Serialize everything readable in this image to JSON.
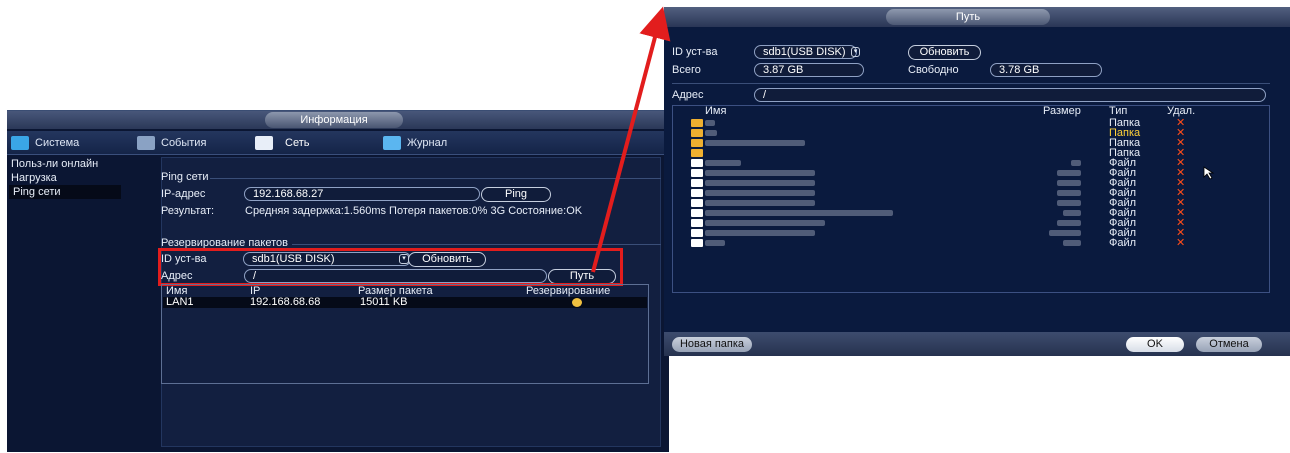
{
  "info_window": {
    "title": "Информация",
    "tabs": [
      {
        "label": "Система",
        "icon": "monitor-icon"
      },
      {
        "label": "События",
        "icon": "events-icon"
      },
      {
        "label": "Сеть",
        "icon": "network-icon"
      },
      {
        "label": "Журнал",
        "icon": "log-icon"
      }
    ],
    "sidebar": [
      "Польз-ли онлайн",
      "Нагрузка",
      "Ping сети"
    ],
    "ping": {
      "section": "Ping сети",
      "ip_label": "IP-адрес",
      "ip_value": "192.168.68.27",
      "ping_button": "Ping",
      "result_label": "Результат:",
      "result_value": "Средняя задержка:1.560ms Потеря пакетов:0% 3G Состояние:OK"
    },
    "backup": {
      "section": "Резервирование пакетов",
      "device_label": "ID уст-ва",
      "device_value": "sdb1(USB DISK)",
      "refresh_button": "Обновить",
      "path_label": "Адрес",
      "path_value": "/",
      "path_button": "Путь"
    },
    "table": {
      "headers": [
        "Имя",
        "IP",
        "Размер пакета",
        "Резервирование"
      ],
      "rows": [
        {
          "name": "LAN1",
          "ip": "192.168.68.68",
          "size": "15011 KB"
        }
      ]
    }
  },
  "path_window": {
    "title": "Путь",
    "device_label": "ID уст-ва",
    "device_value": "sdb1(USB DISK)",
    "refresh_button": "Обновить",
    "total_label": "Всего",
    "total_value": "3.87 GB",
    "free_label": "Свободно",
    "free_value": "3.78 GB",
    "address_label": "Адрес",
    "address_value": "/",
    "columns": [
      "Имя",
      "Размер",
      "Тип",
      "Удал."
    ],
    "files": [
      {
        "type": "Папка",
        "highlight": false,
        "icon": "folder-icon"
      },
      {
        "type": "Папка",
        "highlight": true,
        "icon": "folder-icon"
      },
      {
        "type": "Папка",
        "highlight": false,
        "icon": "folder-icon"
      },
      {
        "type": "Папка",
        "highlight": false,
        "icon": "folder-icon"
      },
      {
        "type": "Файл",
        "highlight": false,
        "icon": "file-icon"
      },
      {
        "type": "Файл",
        "highlight": false,
        "icon": "file-icon"
      },
      {
        "type": "Файл",
        "highlight": false,
        "icon": "file-icon"
      },
      {
        "type": "Файл",
        "highlight": false,
        "icon": "file-icon"
      },
      {
        "type": "Файл",
        "highlight": false,
        "icon": "file-icon"
      },
      {
        "type": "Файл",
        "highlight": false,
        "icon": "file-icon"
      },
      {
        "type": "Файл",
        "highlight": false,
        "icon": "file-icon"
      },
      {
        "type": "Файл",
        "highlight": false,
        "icon": "file-icon"
      },
      {
        "type": "Файл",
        "highlight": false,
        "icon": "file-icon"
      }
    ],
    "delete_glyph": "✕",
    "new_folder_button": "Новая папка",
    "ok_button": "OK",
    "cancel_button": "Отмена"
  },
  "colors": {
    "highlight_red": "#e21d1d",
    "folder": "#f0b030",
    "delete": "#ff4d1a",
    "selected_type": "#ffd23a"
  }
}
